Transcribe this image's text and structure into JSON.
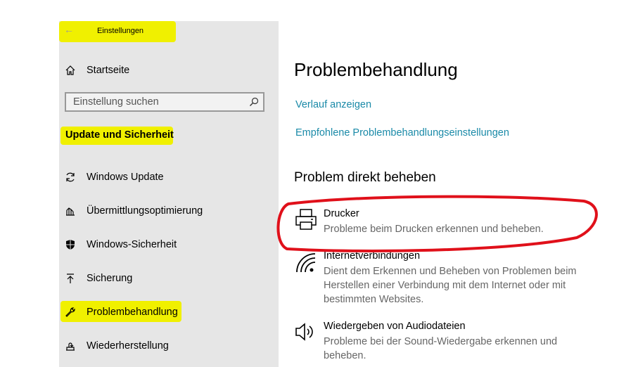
{
  "app": {
    "title": "Einstellungen",
    "back_icon": "arrow-left-icon"
  },
  "sidebar": {
    "home_label": "Startseite",
    "search_placeholder": "Einstellung suchen",
    "section_heading": "Update und Sicherheit",
    "items": [
      {
        "label": "Windows Update",
        "icon": "sync-icon"
      },
      {
        "label": "Übermittlungsoptimierung",
        "icon": "delivery-optimization-icon"
      },
      {
        "label": "Windows-Sicherheit",
        "icon": "shield-icon"
      },
      {
        "label": "Sicherung",
        "icon": "upload-arrow-icon"
      },
      {
        "label": "Problembehandlung",
        "icon": "wrench-icon"
      },
      {
        "label": "Wiederherstellung",
        "icon": "recovery-icon"
      }
    ]
  },
  "main": {
    "title": "Problembehandlung",
    "links": [
      "Verlauf anzeigen",
      "Empfohlene Problembehandlungseinstellungen"
    ],
    "section_heading": "Problem direkt beheben",
    "troubleshooters": [
      {
        "title": "Drucker",
        "description": "Probleme beim Drucken erkennen und beheben.",
        "icon": "printer-icon"
      },
      {
        "title": "Internetverbindungen",
        "description": "Dient dem Erkennen und Beheben von Problemen beim Herstellen einer Verbindung mit dem Internet oder mit bestimmten Websites.",
        "icon": "wifi-icon"
      },
      {
        "title": "Wiedergeben von Audiodateien",
        "description": "Probleme bei der Sound-Wiedergabe erkennen und beheben.",
        "icon": "speaker-icon"
      }
    ]
  },
  "colors": {
    "highlight": "#f0f000",
    "link": "#1a8aa8",
    "annotation": "#e0101a",
    "sidebar_bg": "#e6e6e6"
  }
}
